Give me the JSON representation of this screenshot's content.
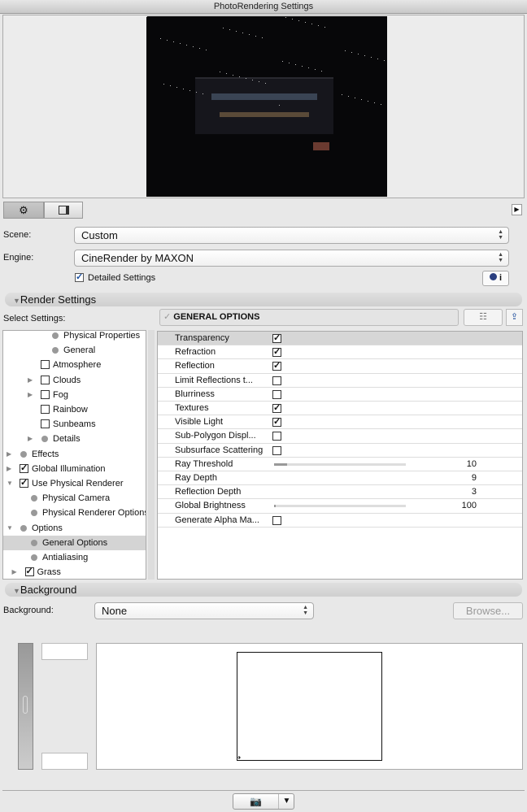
{
  "window": {
    "title": "PhotoRendering Settings"
  },
  "tabs": [
    {
      "icon": "gear-icon",
      "active": true
    },
    {
      "icon": "layout-size-icon",
      "active": false
    }
  ],
  "scene": {
    "label": "Scene:",
    "value": "Custom"
  },
  "engine": {
    "label": "Engine:",
    "value": "CineRender by MAXON"
  },
  "detailed_settings": {
    "label": "Detailed Settings",
    "checked": true
  },
  "render_settings": {
    "title": "Render Settings",
    "select_label": "Select Settings:",
    "current": "GENERAL OPTIONS"
  },
  "tree": [
    {
      "label": "Physical Properties",
      "type": "dot",
      "level": 3
    },
    {
      "label": "General",
      "type": "dot",
      "level": 3
    },
    {
      "label": "Atmosphere",
      "type": "check",
      "checked": false,
      "level": 2
    },
    {
      "label": "Clouds",
      "type": "check",
      "checked": false,
      "level": 2,
      "expander": "collapsed"
    },
    {
      "label": "Fog",
      "type": "check",
      "checked": false,
      "level": 2,
      "expander": "collapsed"
    },
    {
      "label": "Rainbow",
      "type": "check",
      "checked": false,
      "level": 2
    },
    {
      "label": "Sunbeams",
      "type": "check",
      "checked": false,
      "level": 2
    },
    {
      "label": "Details",
      "type": "dot",
      "level": 2,
      "expander": "collapsed"
    },
    {
      "label": "Effects",
      "type": "dot",
      "level": 0,
      "expander": "collapsed"
    },
    {
      "label": "Global Illumination",
      "type": "check",
      "checked": true,
      "level": 0,
      "expander": "collapsed"
    },
    {
      "label": "Use Physical Renderer",
      "type": "check",
      "checked": true,
      "level": 0,
      "expander": "expanded"
    },
    {
      "label": "Physical Camera",
      "type": "dot",
      "level": 1
    },
    {
      "label": "Physical Renderer Options",
      "type": "dot",
      "level": 1
    },
    {
      "label": "Options",
      "type": "dot",
      "level": 0,
      "expander": "expanded"
    },
    {
      "label": "General Options",
      "type": "dot",
      "level": 1,
      "selected": true
    },
    {
      "label": "Antialiasing",
      "type": "dot",
      "level": 1
    },
    {
      "label": "Grass",
      "type": "check",
      "checked": true,
      "level": 0.5,
      "expander": "collapsed"
    }
  ],
  "options": [
    {
      "label": "Transparency",
      "type": "check",
      "checked": true,
      "selected": true
    },
    {
      "label": "Refraction",
      "type": "check",
      "checked": true
    },
    {
      "label": "Reflection",
      "type": "check",
      "checked": true
    },
    {
      "label": "Limit Reflections t...",
      "type": "check",
      "checked": false
    },
    {
      "label": "Blurriness",
      "type": "check",
      "checked": false
    },
    {
      "label": "Textures",
      "type": "check",
      "checked": true
    },
    {
      "label": "Visible Light",
      "type": "check",
      "checked": true
    },
    {
      "label": "Sub-Polygon Displ...",
      "type": "check",
      "checked": false
    },
    {
      "label": "Subsurface Scattering",
      "type": "check",
      "checked": false
    },
    {
      "label": "Ray Threshold",
      "type": "slider",
      "value": "10",
      "fraction": 0.1
    },
    {
      "label": "Ray Depth",
      "type": "number",
      "value": "9"
    },
    {
      "label": "Reflection Depth",
      "type": "number",
      "value": "3"
    },
    {
      "label": "Global Brightness",
      "type": "slider",
      "value": "100",
      "fraction": 0.0
    },
    {
      "label": "Generate Alpha Ma...",
      "type": "check",
      "checked": false
    }
  ],
  "background": {
    "title": "Background",
    "label": "Background:",
    "value": "None",
    "browse": "Browse..."
  },
  "colors": {
    "window": "#e8e8e8",
    "render_bg": "#070709"
  }
}
